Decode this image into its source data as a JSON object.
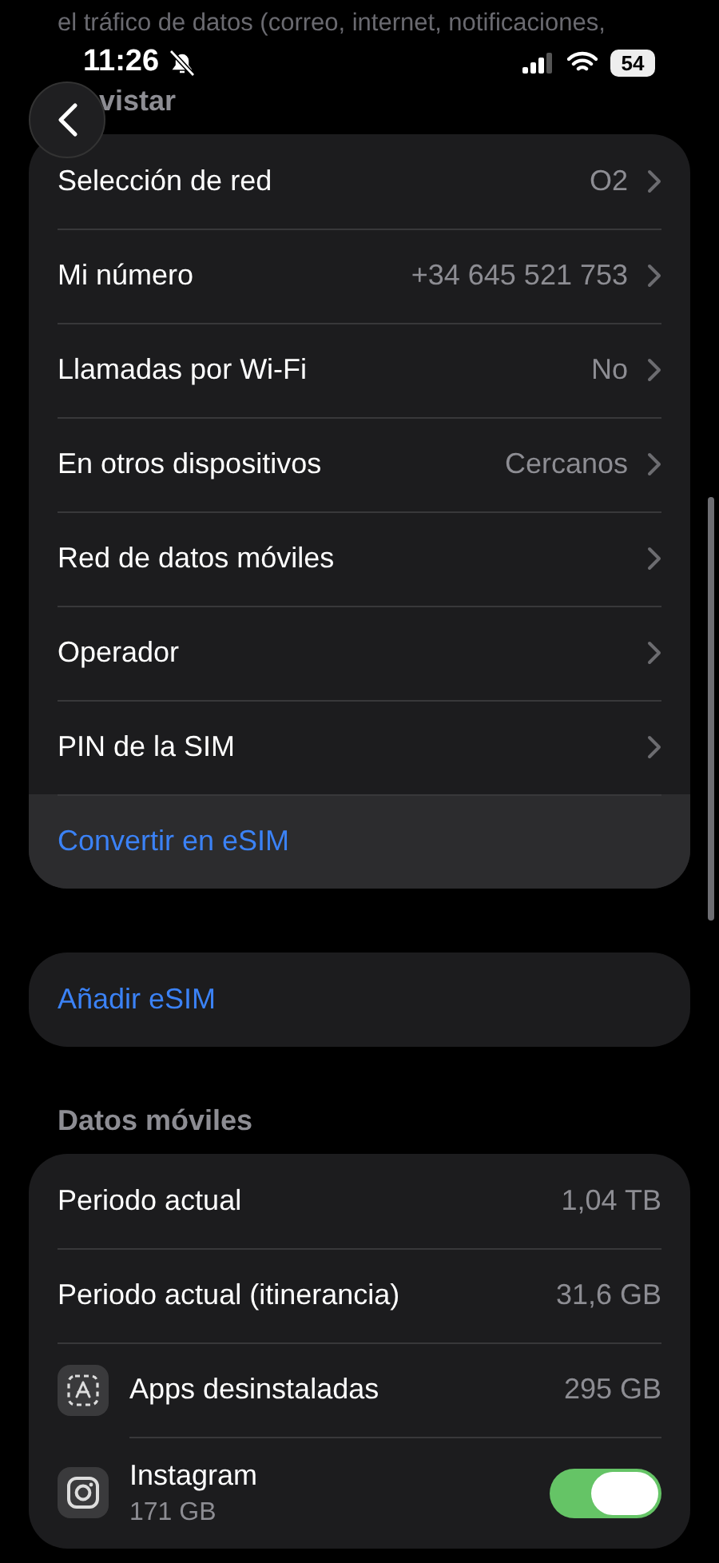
{
  "faded_note": "el tráfico de datos (correo, internet, notificaciones,",
  "status_bar": {
    "time": "11:26",
    "battery": "54"
  },
  "section_header": "vistar",
  "carrier_rows": [
    {
      "kind": "nav",
      "label": "Selección de red",
      "value": "O2",
      "highlighted": false
    },
    {
      "kind": "nav",
      "label": "Mi número",
      "value": "+34 645 521 753",
      "highlighted": false
    },
    {
      "kind": "nav",
      "label": "Llamadas por Wi-Fi",
      "value": "No",
      "highlighted": false
    },
    {
      "kind": "nav",
      "label": "En otros dispositivos",
      "value": "Cercanos",
      "highlighted": false
    },
    {
      "kind": "nav",
      "label": "Red de datos móviles",
      "highlighted": false
    },
    {
      "kind": "nav",
      "label": "Operador",
      "highlighted": false
    },
    {
      "kind": "nav",
      "label": "PIN de la SIM",
      "highlighted": false
    },
    {
      "kind": "action",
      "label": "Convertir en eSIM",
      "highlighted": true
    }
  ],
  "add_esim": "Añadir eSIM",
  "data_header": "Datos móviles",
  "data_rows": [
    {
      "kind": "stat",
      "label": "Periodo actual",
      "value": "1,04 TB"
    },
    {
      "kind": "stat",
      "label": "Periodo actual (itinerancia)",
      "value": "31,6 GB"
    },
    {
      "kind": "uninstalled_apps",
      "label": "Apps desinstaladas",
      "value": "295 GB"
    },
    {
      "kind": "app",
      "label": "Instagram",
      "value": "171 GB",
      "on": true
    }
  ]
}
